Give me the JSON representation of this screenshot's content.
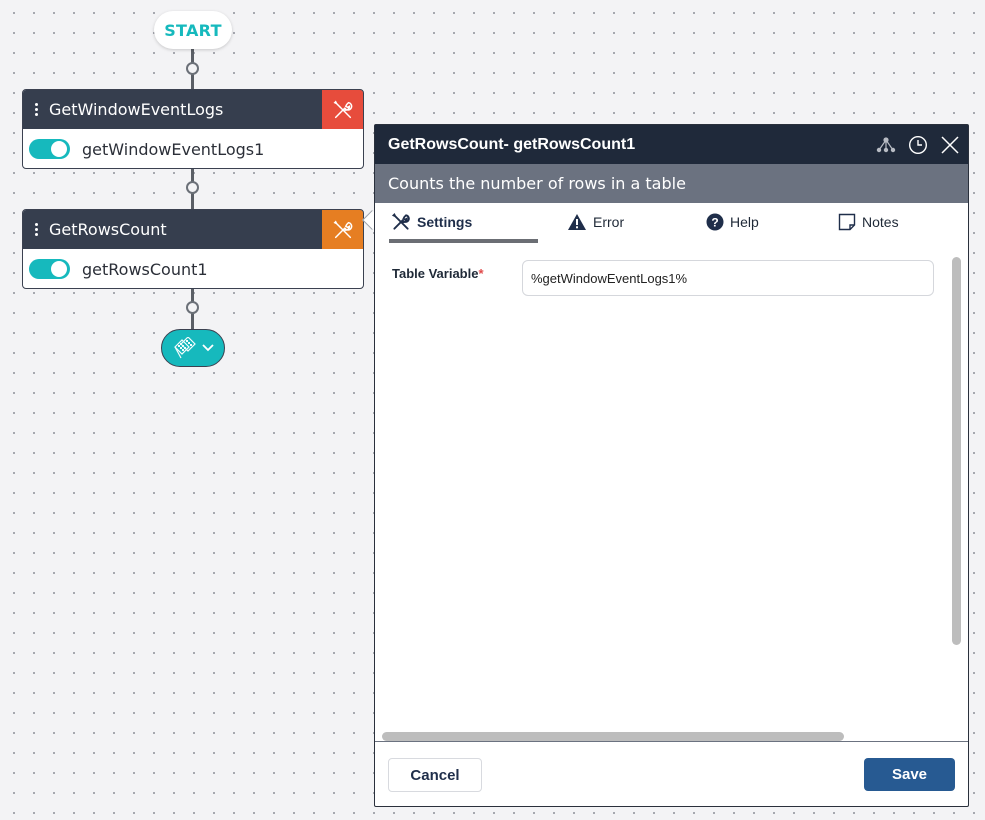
{
  "canvas": {
    "start_label": "START",
    "nodes": [
      {
        "title": "GetWindowEventLogs",
        "instance": "getWindowEventLogs1",
        "enabled": true,
        "tool_color": "#e74c3c"
      },
      {
        "title": "GetRowsCount",
        "instance": "getRowsCount1",
        "enabled": true,
        "tool_color": "#e67e22"
      }
    ],
    "end_icon": "checkered-flag-icon"
  },
  "panel": {
    "title": "GetRowsCount-  getRowsCount1",
    "description": "Counts the number of rows in a table",
    "header_icons": [
      "hierarchy-icon",
      "history-clock-icon",
      "close-icon"
    ],
    "tabs": [
      {
        "label": "Settings",
        "icon": "wrench-screwdriver-icon",
        "active": true
      },
      {
        "label": "Error",
        "icon": "warning-triangle-icon",
        "active": false
      },
      {
        "label": "Help",
        "icon": "question-circle-icon",
        "active": false
      },
      {
        "label": "Notes",
        "icon": "note-icon",
        "active": false
      }
    ],
    "fields": [
      {
        "label": "Table Variable",
        "required_mark": "*",
        "value": "%getWindowEventLogs1%"
      }
    ],
    "footer": {
      "cancel_label": "Cancel",
      "save_label": "Save"
    }
  },
  "colors": {
    "accent": "#16b9bd",
    "save": "#275a92",
    "header": "#1f293a",
    "node_head": "#363e4e"
  }
}
